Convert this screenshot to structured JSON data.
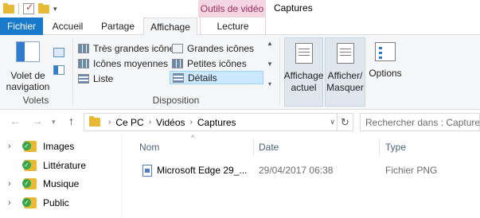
{
  "window": {
    "title": "Captures",
    "context_tab_group": "Outils de vidéo"
  },
  "tabs": [
    "Fichier",
    "Accueil",
    "Partage",
    "Affichage",
    "Lecture"
  ],
  "ribbon": {
    "volets": {
      "nav_pane_button": "Volet de navigation",
      "group_label": "Volets"
    },
    "disposition": {
      "group_label": "Disposition",
      "items": {
        "extra_large": "Très grandes icônes",
        "large": "Grandes icônes",
        "medium": "Icônes moyennes",
        "small": "Petites icônes",
        "list": "Liste",
        "details": "Détails"
      },
      "selected": "Détails"
    },
    "current_view_button": "Affichage actuel",
    "show_hide_button": "Afficher/ Masquer",
    "options_button": "Options"
  },
  "address": {
    "crumbs": [
      "Ce PC",
      "Vidéos",
      "Captures"
    ],
    "search_placeholder": "Rechercher dans : Captures"
  },
  "nav_pane": {
    "items": [
      "Images",
      "Littérature",
      "Musique",
      "Public"
    ]
  },
  "file_list": {
    "columns": [
      "Nom",
      "Date",
      "Type"
    ],
    "rows": [
      {
        "name": "Microsoft Edge 29_...",
        "date": "29/04/2017 06:38",
        "type": "Fichier PNG"
      }
    ]
  },
  "colors": {
    "file_tab": "#1979ca",
    "context_tab": "#f4d6e2",
    "selection": "#cce8ff"
  }
}
